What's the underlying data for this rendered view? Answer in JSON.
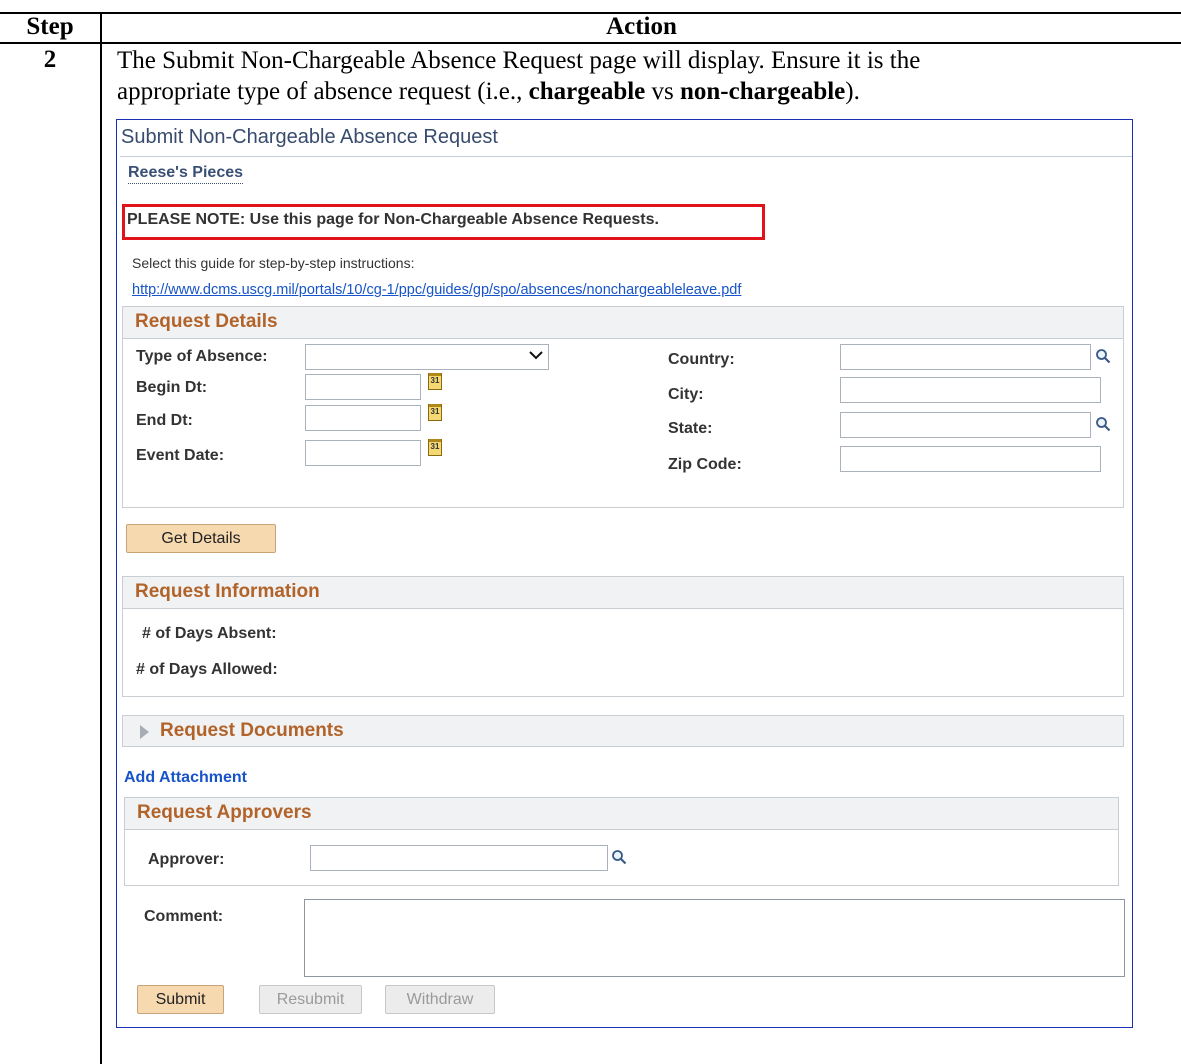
{
  "doc": {
    "header_step": "Step",
    "header_action": "Action",
    "step_number": "2",
    "action_line1": "The Submit Non-Chargeable Absence Request page will display. Ensure it is the",
    "action_line2_pre": "appropriate type of absence request (i.e., ",
    "action_bold1": "chargeable",
    "action_mid": " vs ",
    "action_bold2": "non-chargeable",
    "action_post": ")."
  },
  "page": {
    "title": "Submit Non-Chargeable Absence Request",
    "person_name": "Reese's Pieces",
    "note": "PLEASE NOTE: Use this page for Non-Chargeable Absence Requests.",
    "guide_text": "Select this guide for step-by-step instructions:",
    "guide_link": "http://www.dcms.uscg.mil/portals/10/cg-1/ppc/guides/gp/spo/absences/nonchargeableleave.pdf"
  },
  "request_details": {
    "header": "Request Details",
    "type_of_absence_label": "Type of Absence:",
    "type_of_absence_value": "",
    "begin_dt_label": "Begin Dt:",
    "end_dt_label": "End Dt:",
    "event_date_label": "Event Date:",
    "country_label": "Country:",
    "city_label": "City:",
    "state_label": "State:",
    "zip_label": "Zip Code:",
    "calendar_icon_text": "31"
  },
  "get_details_button": "Get Details",
  "request_information": {
    "header": "Request Information",
    "days_absent_label": "# of Days Absent:",
    "days_allowed_label": "# of Days Allowed:"
  },
  "request_documents": {
    "header": "Request Documents",
    "add_attachment": "Add Attachment"
  },
  "request_approvers": {
    "header": "Request Approvers",
    "approver_label": "Approver:"
  },
  "comment_label": "Comment:",
  "buttons": {
    "submit": "Submit",
    "resubmit": "Resubmit",
    "withdraw": "Withdraw"
  },
  "colors": {
    "section_header_text": "#b2632a",
    "link": "#1754c9",
    "note_highlight": "#e0131a",
    "frame_border": "#1c2fb8"
  }
}
